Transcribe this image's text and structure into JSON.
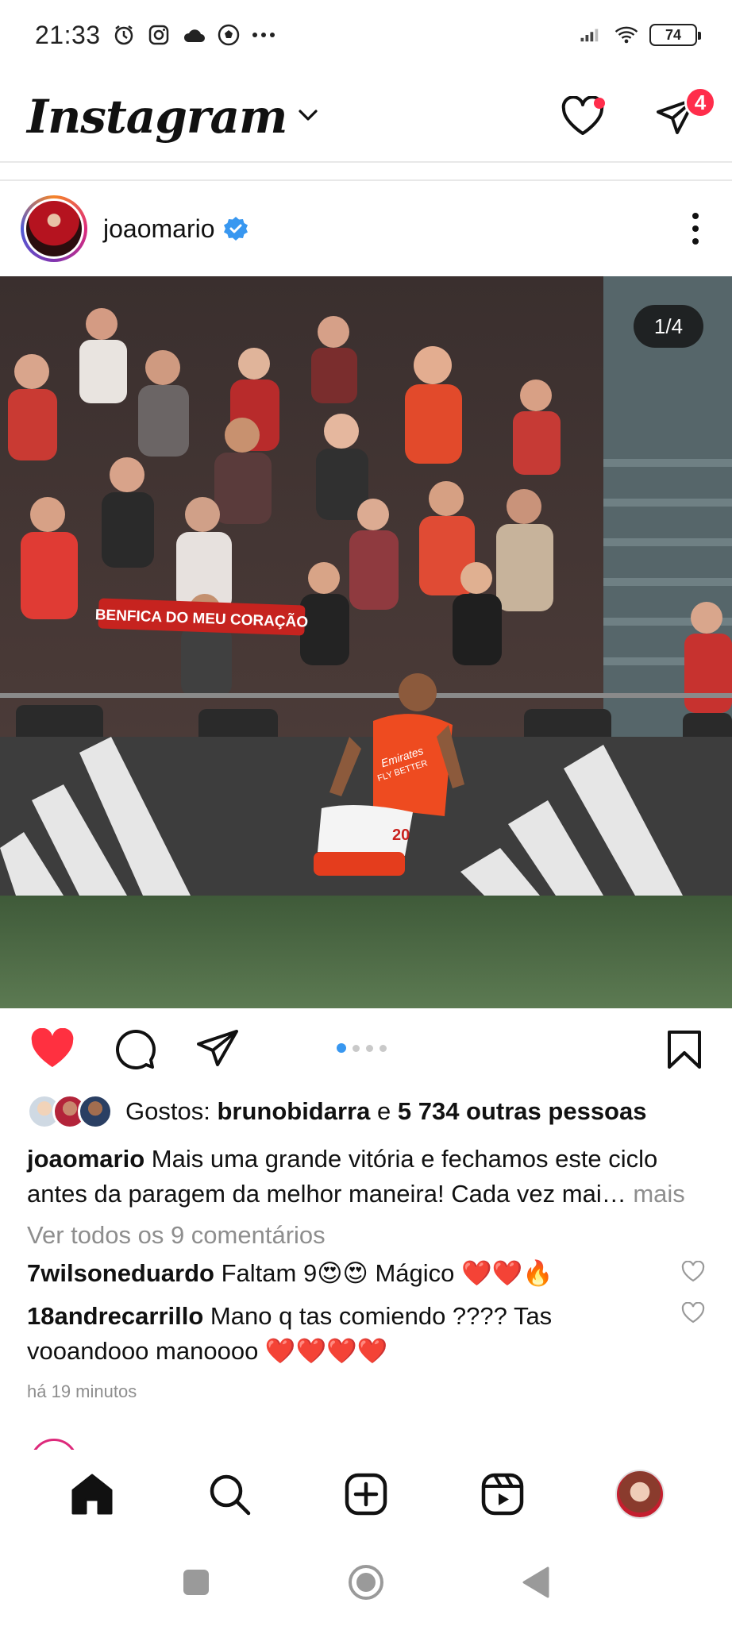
{
  "status_bar": {
    "time": "21:33",
    "battery": "74",
    "icons": [
      "alarm-icon",
      "instagram-notification-icon",
      "cloud-icon",
      "soccer-ball-icon",
      "more-notifications-icon",
      "signal-icon",
      "wifi-icon",
      "battery-icon"
    ]
  },
  "header": {
    "logo_text": "Instagram",
    "dm_badge": "4",
    "accent_red": "#ff2d4b"
  },
  "post": {
    "username": "joaomario",
    "verified": true,
    "page_counter": "1/4",
    "image_text": {
      "banner": "BENFICA DO MEU CORAÇÃO",
      "shirt_sponsor": "Emirates FLY BETTER",
      "shirt_number": "20"
    },
    "carousel": {
      "count": 4,
      "active_index": 0
    },
    "likes": {
      "prefix": "Gostos:",
      "first_liker": "brunobidarra",
      "connector": "e",
      "others": "5 734 outras pessoas"
    },
    "caption": {
      "author": "joaomario",
      "text": "Mais uma grande vitória e fechamos este ciclo antes da paragem da melhor maneira! Cada vez mai…",
      "more": "mais"
    },
    "view_comments": "Ver todos os 9 comentários",
    "comments": [
      {
        "author": "7wilsoneduardo",
        "text": "Faltam 9😍😍 Mágico ❤️❤️🔥"
      },
      {
        "author": "18andrecarrillo",
        "text": "Mano q tas comiendo ???? Tas vooandooo manoooo ❤️❤️❤️❤️"
      }
    ],
    "timestamp": "há 19 minutos"
  },
  "bottom_nav": [
    "home-icon",
    "search-icon",
    "create-post-icon",
    "reels-icon",
    "profile-avatar"
  ],
  "system_nav": [
    "recents-button",
    "home-button",
    "back-button"
  ],
  "colors": {
    "verified_blue": "#3897f0",
    "like_red": "#ff3040",
    "muted_text": "#8e8e8e"
  }
}
